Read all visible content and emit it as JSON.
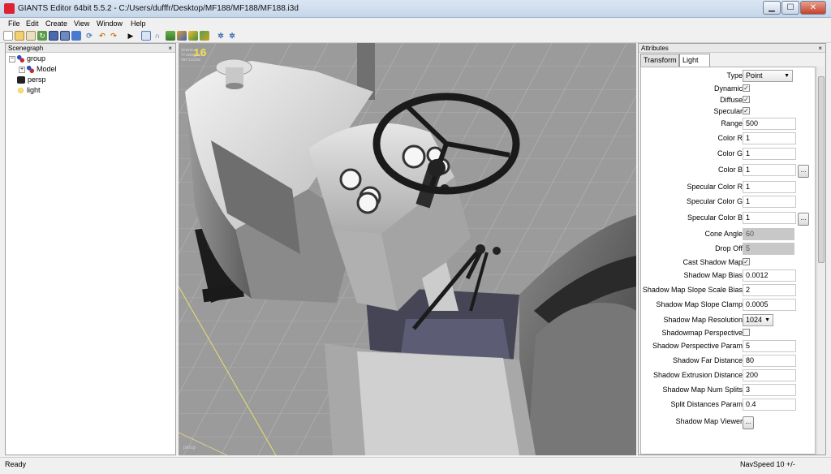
{
  "window": {
    "title": "GIANTS Editor 64bit 5.5.2 - C:/Users/dufffr/Desktop/MF188/MF188/MF188.i3d",
    "min_label": "▁",
    "max_label": "☐",
    "close_label": "✕"
  },
  "menu": [
    "File",
    "Edit",
    "Create",
    "View",
    "Window",
    "Help"
  ],
  "scenegraph": {
    "title": "Scenegraph",
    "close_label": "×",
    "items": [
      {
        "label": "group",
        "expander": "−",
        "icon": "group-icon"
      },
      {
        "label": "Model",
        "expander": "+",
        "icon": "transform-icon"
      },
      {
        "label": "persp",
        "expander": "",
        "icon": "camera-icon"
      },
      {
        "label": "light",
        "expander": "",
        "icon": "light-bulb-icon"
      }
    ]
  },
  "viewport": {
    "overlay_lines": [
      "Scene",
      "Triangles",
      "Vertices"
    ],
    "fps": "16",
    "camera_label": "persp",
    "colors": {
      "floor": "#9a9a9a",
      "grid": "#b8b8b8",
      "axis": "#e8e070"
    }
  },
  "attributes": {
    "title": "Attributes",
    "close_label": "×",
    "tabs": [
      "Transform",
      "Light"
    ],
    "active_tab": "Light",
    "browse_label": "...",
    "props": [
      {
        "label": "Type",
        "kind": "select",
        "value": "Point"
      },
      {
        "label": "Dynamic",
        "kind": "check",
        "value": "✓"
      },
      {
        "label": "Diffuse",
        "kind": "check",
        "value": "✓"
      },
      {
        "label": "Specular",
        "kind": "check",
        "value": "✓"
      },
      {
        "label": "Range",
        "kind": "text",
        "value": "500"
      },
      {
        "label": "Color R",
        "kind": "text",
        "value": "1"
      },
      {
        "label": "Color G",
        "kind": "text",
        "value": "1"
      },
      {
        "label": "Color B",
        "kind": "text-btn",
        "value": "1"
      },
      {
        "label": "Specular Color R",
        "kind": "text",
        "value": "1"
      },
      {
        "label": "Specular Color G",
        "kind": "text",
        "value": "1"
      },
      {
        "label": "Specular Color B",
        "kind": "text-btn",
        "value": "1"
      },
      {
        "label": "Cone Angle",
        "kind": "disabled",
        "value": "60"
      },
      {
        "label": "Drop Off",
        "kind": "disabled",
        "value": "5"
      },
      {
        "label": "Cast Shadow Map",
        "kind": "check",
        "value": "✓"
      },
      {
        "label": "Shadow Map Bias",
        "kind": "text",
        "value": "0.0012"
      },
      {
        "label": "Shadow Map Slope Scale Bias",
        "kind": "text",
        "value": "2"
      },
      {
        "label": "Shadow Map Slope Clamp",
        "kind": "text",
        "value": "0.0005"
      },
      {
        "label": "Shadow Map Resolution",
        "kind": "select",
        "value": "1024"
      },
      {
        "label": "Shadowmap Perspective",
        "kind": "check",
        "value": ""
      },
      {
        "label": "Shadow Perspective Param",
        "kind": "text",
        "value": "5"
      },
      {
        "label": "Shadow Far Distance",
        "kind": "text",
        "value": "80"
      },
      {
        "label": "Shadow Extrusion Distance",
        "kind": "text",
        "value": "200"
      },
      {
        "label": "Shadow Map Num Splits",
        "kind": "text",
        "value": "3"
      },
      {
        "label": "Split Distances Param",
        "kind": "text",
        "value": "0.4"
      },
      {
        "label": "Shadow Map Viewer",
        "kind": "button",
        "value": ""
      }
    ]
  },
  "status": {
    "left": "Ready",
    "right": "NavSpeed 10 +/-"
  }
}
